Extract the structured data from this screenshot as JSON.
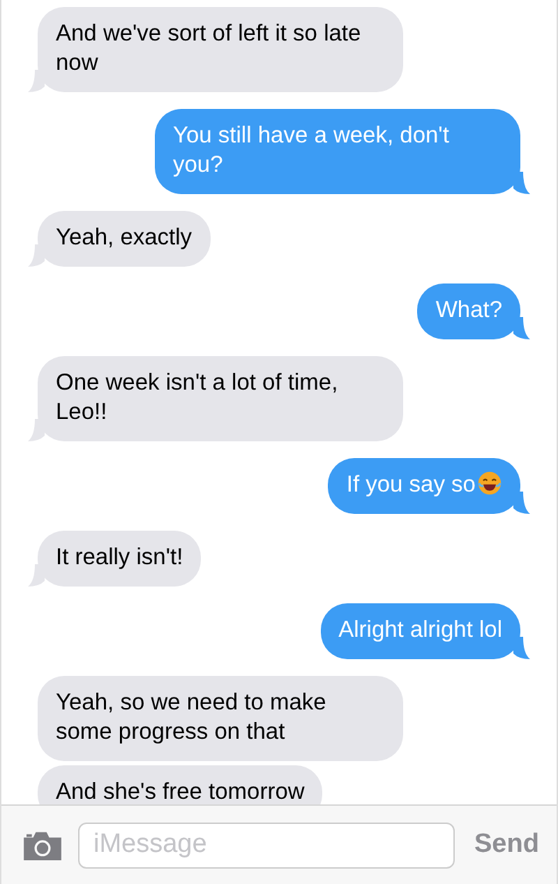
{
  "messages": [
    {
      "kind": "received",
      "text": "And we've sort of left it so late now",
      "tail": true
    },
    {
      "kind": "sent",
      "text": "You still have a week, don't you?",
      "tail": true
    },
    {
      "kind": "received",
      "text": "Yeah, exactly",
      "tail": true
    },
    {
      "kind": "sent",
      "text": "What?",
      "tail": true
    },
    {
      "kind": "received",
      "text": "One week isn't a lot of time, Leo!!",
      "tail": true
    },
    {
      "kind": "sent",
      "text": "If you say so",
      "emoji": true,
      "tail": true
    },
    {
      "kind": "received",
      "text": "It really isn't!",
      "tail": true
    },
    {
      "kind": "sent",
      "text": "Alright alright lol",
      "tail": true
    },
    {
      "kind": "received",
      "text": "Yeah, so we need to make some progress on that",
      "tail": false
    },
    {
      "kind": "received",
      "text": "And she's free tomorrow",
      "tail": false
    }
  ],
  "composer": {
    "placeholder": "iMessage",
    "send": "Send"
  }
}
